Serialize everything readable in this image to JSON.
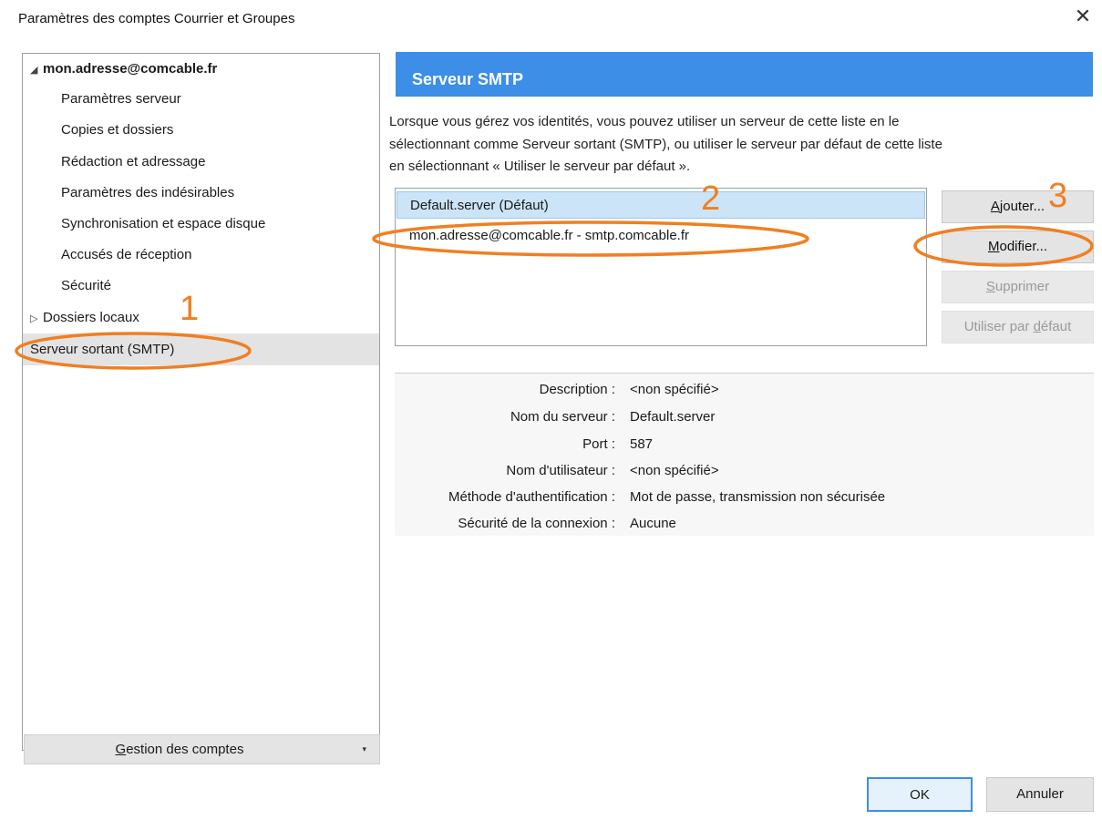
{
  "window": {
    "title": "Paramètres des comptes Courrier et Groupes",
    "close_glyph": "✕"
  },
  "tree": {
    "account": "mon.adresse@comcable.fr",
    "items": [
      "Paramètres serveur",
      "Copies et dossiers",
      "Rédaction et adressage",
      "Paramètres des indésirables",
      "Synchronisation et espace disque",
      "Accusés de réception",
      "Sécurité"
    ],
    "local_folders": "Dossiers locaux",
    "smtp": "Serveur sortant (SMTP)"
  },
  "gestion": {
    "prefix": "",
    "accel": "G",
    "rest": "estion des comptes",
    "arrow": "▾"
  },
  "panel": {
    "header": "Serveur SMTP",
    "description_lines": [
      "Lorsque vous gérez vos identités, vous pouvez utiliser un serveur de cette liste en le",
      "sélectionnant comme Serveur sortant (SMTP), ou utiliser le serveur par défaut de cette liste",
      "en sélectionnant « Utiliser le serveur par défaut »."
    ]
  },
  "servers": [
    "Default.server (Défaut)",
    "mon.adresse@comcable.fr - smtp.comcable.fr"
  ],
  "buttons": {
    "add": {
      "accel": "A",
      "rest": "jouter..."
    },
    "edit": {
      "accel": "M",
      "rest": "odifier..."
    },
    "delete": {
      "accel": "S",
      "rest": "upprimer"
    },
    "default": {
      "pre": "Utiliser par ",
      "accel": "d",
      "rest": "éfaut"
    }
  },
  "details": [
    {
      "key": "Description :",
      "value": "<non spécifié>"
    },
    {
      "key": "Nom du serveur :",
      "value": "Default.server"
    },
    {
      "key": "Port :",
      "value": "587"
    },
    {
      "key": "Nom d'utilisateur :",
      "value": "<non spécifié>"
    },
    {
      "key": "Méthode d'authentification :",
      "value": "Mot de passe, transmission non sécurisée"
    },
    {
      "key": "Sécurité de la connexion :",
      "value": "Aucune"
    }
  ],
  "footer": {
    "ok": "OK",
    "cancel": "Annuler"
  },
  "annotations": {
    "n1": "1",
    "n2": "2",
    "n3": "3",
    "color": "#f07f21"
  },
  "colors": {
    "header_bg": "#3c8ee6",
    "selected_row": "#cce4f7"
  }
}
